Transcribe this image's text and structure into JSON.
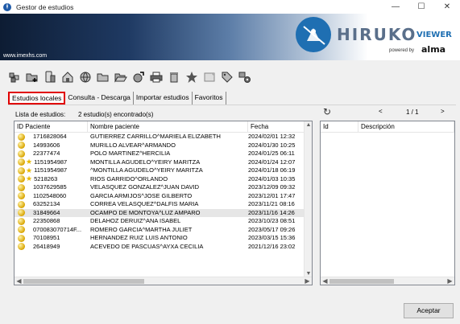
{
  "window": {
    "title": "Gestor de estudios",
    "controls": [
      "—",
      "☐",
      "✕"
    ]
  },
  "banner": {
    "url": "www.imexhs.com",
    "logo_main": "HIRUKO",
    "logo_sub": "VIEWER",
    "powered": "powered by",
    "brand": "alma"
  },
  "toolbar": {
    "icons": [
      "cubes-icon",
      "add-folder-icon",
      "phone-study-icon",
      "home-export-icon",
      "globe-icon",
      "folder-icon",
      "open-folder-icon",
      "globe-arrow-icon",
      "printer-icon",
      "trash-icon",
      "star-icon",
      "note-icon",
      "tag-icon",
      "settings-icon"
    ]
  },
  "tabs": [
    {
      "label": "Estudios locales",
      "active": true
    },
    {
      "label": "Consulta - Descarga",
      "active": false
    },
    {
      "label": "Importar estudios",
      "active": false
    },
    {
      "label": "Favoritos",
      "active": false
    }
  ],
  "list": {
    "label": "Lista de estudios:",
    "count": "2 estudio(s) encontrado(s)"
  },
  "table": {
    "columns": [
      "ID Paciente",
      "Nombre paciente",
      "Fecha"
    ],
    "rows": [
      {
        "id": "1716828064",
        "name": "GUTIERREZ CARRILLO^MARIELA ELIZABETH",
        "date": "2024/02/01 12:32",
        "star": false,
        "selected": false
      },
      {
        "id": "14993606",
        "name": "MURILLO ALVEAR^ARMANDO",
        "date": "2024/01/30 10:25",
        "star": false,
        "selected": false
      },
      {
        "id": "22377474",
        "name": "POLO MARTINEZ^HERCILIA",
        "date": "2024/01/25 06:11",
        "star": false,
        "selected": false
      },
      {
        "id": "1151954987",
        "name": "MONTILLA AGUDELO^YEIRY MARITZA",
        "date": "2024/01/24 12:07",
        "star": true,
        "selected": false
      },
      {
        "id": "1151954987",
        "name": "^MONTILLA AGUDELO^YEIRY MARITZA",
        "date": "2024/01/18 06:19",
        "star": true,
        "selected": false
      },
      {
        "id": "5218263",
        "name": "RIOS GARRIDO^ORLANDO",
        "date": "2024/01/03 10:35",
        "star": true,
        "selected": false
      },
      {
        "id": "1037629585",
        "name": "VELASQUEZ GONZALEZ^JUAN DAVID",
        "date": "2023/12/09 09:32",
        "star": false,
        "selected": false
      },
      {
        "id": "1102548060",
        "name": "GARCIA ARMIJOS^JOSE GILBERTO",
        "date": "2023/12/01 17:47",
        "star": false,
        "selected": false
      },
      {
        "id": "63252134",
        "name": "CORREA VELASQUEZ^DALFIS MARIA",
        "date": "2023/11/21 08:16",
        "star": false,
        "selected": false
      },
      {
        "id": "31849664",
        "name": "OCAMPO DE MONTOYA^LUZ AMPARO",
        "date": "2023/11/16 14:26",
        "star": false,
        "selected": true
      },
      {
        "id": "22350868",
        "name": "DELAHOZ DERUIZ^ANA ISABEL",
        "date": "2023/10/23 08:51",
        "star": false,
        "selected": false
      },
      {
        "id": "070083070714F...",
        "name": "ROMERO GARCIA^MARTHA JULIET",
        "date": "2023/05/17 09:26",
        "star": false,
        "selected": false
      },
      {
        "id": "70108951",
        "name": "HERNANDEZ RUIZ LUIS ANTONIO",
        "date": "2023/03/15 15:36",
        "star": false,
        "selected": false
      },
      {
        "id": "26418949",
        "name": "ACEVEDO DE PASCUAS^AYXA CECILIA",
        "date": "2021/12/16 23:02",
        "star": false,
        "selected": false
      }
    ]
  },
  "side": {
    "prev": "<",
    "next": ">",
    "page": "1 / 1",
    "columns": [
      "Id",
      "Descripción"
    ]
  },
  "footer": {
    "accept": "Aceptar"
  }
}
